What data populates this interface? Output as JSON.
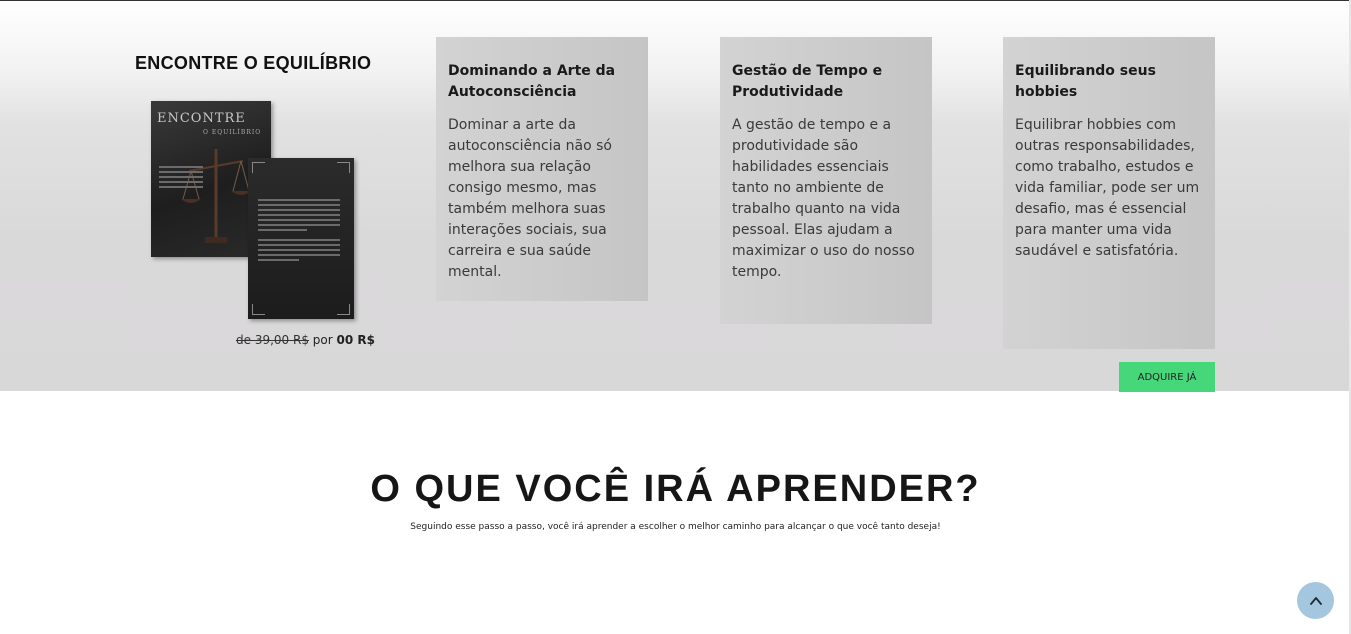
{
  "product": {
    "title": "ENCONTRE O EQUILÍBRIO",
    "book_cover_title": "ENCONTRE",
    "book_cover_subtitle": "O EQUILÍBRIO",
    "old_price": "de 39,00 R$",
    "price_connector": "por",
    "new_price": "00 R$"
  },
  "cards": [
    {
      "title": "Dominando a Arte da Autoconsciência",
      "text": "Dominar a arte da autoconsciência não só melhora sua relação consigo mesmo, mas também melhora suas interações sociais, sua carreira e sua saúde mental."
    },
    {
      "title": "Gestão de Tempo e Produtividade",
      "text": "A gestão de tempo e a produtividade são habilidades essenciais tanto no ambiente de trabalho quanto na vida pessoal. Elas ajudam a maximizar o uso do nosso tempo."
    },
    {
      "title": "Equilibrando seus hobbies",
      "text": "Equilibrar hobbies com outras responsabilidades, como trabalho, estudos e vida familiar, pode ser um desafio, mas é essencial para manter uma vida saudável e satisfatória."
    }
  ],
  "cta": {
    "label": "ADQUIRE JÁ",
    "color": "#47d77b"
  },
  "learn": {
    "title": "O QUE VOCÊ IRÁ APRENDER?",
    "subtitle": "Seguindo esse passo a passo, você irá aprender a escolher o melhor caminho para alcançar o que você tanto deseja!"
  },
  "back_to_top": {
    "icon": "chevron-up-icon",
    "color": "#a4c6de"
  }
}
